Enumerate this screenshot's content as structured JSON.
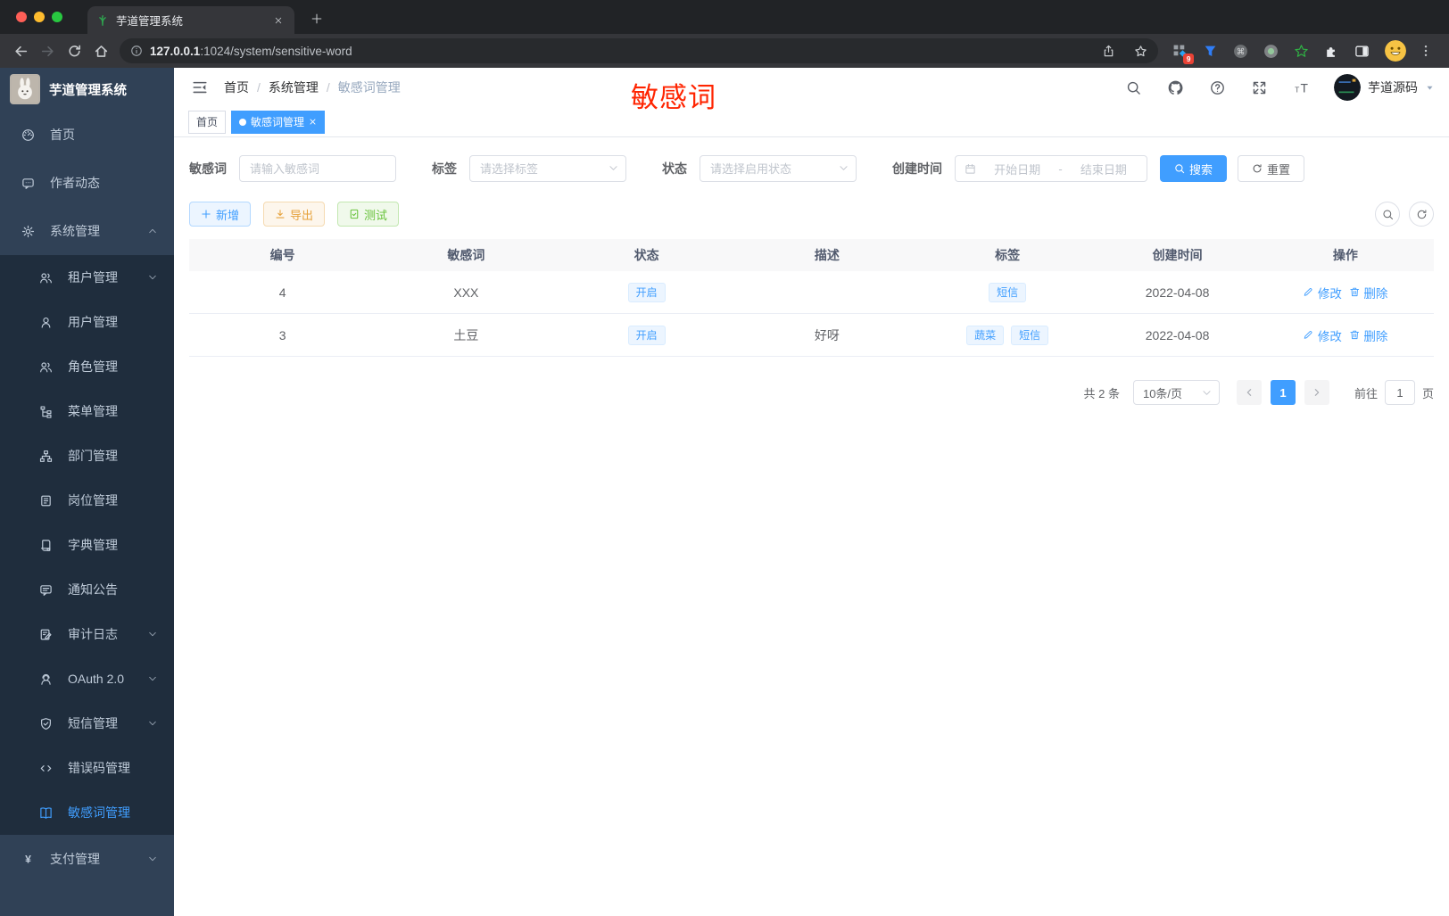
{
  "colors": {
    "accent": "#409eff",
    "warning": "#e6a23c",
    "success": "#67c23a",
    "annotation_red": "#ff2400",
    "sidebar_bg": "#304156",
    "submenu_bg": "#1f2d3d"
  },
  "browser": {
    "tab_title": "芋道管理系统",
    "url_host": "127.0.0.1",
    "url_path": ":1024/system/sensitive-word",
    "extension_badge": "9"
  },
  "sidebar": {
    "title": "芋道管理系统",
    "menu": [
      {
        "label": "首页",
        "icon": "dashboard"
      },
      {
        "label": "作者动态",
        "icon": "chat"
      },
      {
        "label": "系统管理",
        "icon": "gear",
        "expanded": true,
        "children": [
          {
            "label": "租户管理",
            "icon": "users",
            "arrow": true
          },
          {
            "label": "用户管理",
            "icon": "user"
          },
          {
            "label": "角色管理",
            "icon": "users"
          },
          {
            "label": "菜单管理",
            "icon": "tree"
          },
          {
            "label": "部门管理",
            "icon": "org"
          },
          {
            "label": "岗位管理",
            "icon": "badge"
          },
          {
            "label": "字典管理",
            "icon": "dict"
          },
          {
            "label": "通知公告",
            "icon": "announce"
          },
          {
            "label": "审计日志",
            "icon": "log",
            "arrow": true
          },
          {
            "label": "OAuth 2.0",
            "icon": "oauth",
            "arrow": true
          },
          {
            "label": "短信管理",
            "icon": "shield",
            "arrow": true
          },
          {
            "label": "错误码管理",
            "icon": "code"
          },
          {
            "label": "敏感词管理",
            "icon": "book",
            "active": true
          }
        ]
      },
      {
        "label": "支付管理",
        "icon": "yen",
        "arrow": true
      }
    ]
  },
  "header": {
    "breadcrumb": [
      "首页",
      "系统管理",
      "敏感词管理"
    ],
    "annotation": "敏感词",
    "user_name": "芋道源码"
  },
  "tags_view": [
    {
      "label": "首页"
    },
    {
      "label": "敏感词管理",
      "active": true,
      "closable": true
    }
  ],
  "filters": {
    "keyword_label": "敏感词",
    "keyword_placeholder": "请输入敏感词",
    "tag_label": "标签",
    "tag_placeholder": "请选择标签",
    "status_label": "状态",
    "status_placeholder": "请选择启用状态",
    "date_label": "创建时间",
    "date_start_placeholder": "开始日期",
    "date_separator": "-",
    "date_end_placeholder": "结束日期",
    "search_label": "搜索",
    "reset_label": "重置"
  },
  "toolbar": {
    "add_label": "新增",
    "export_label": "导出",
    "test_label": "测试"
  },
  "table": {
    "columns": [
      "编号",
      "敏感词",
      "状态",
      "描述",
      "标签",
      "创建时间",
      "操作"
    ],
    "edit_label": "修改",
    "delete_label": "删除",
    "rows": [
      {
        "id": "4",
        "word": "XXX",
        "status": "开启",
        "description": "",
        "tags": [
          "短信"
        ],
        "created_at": "2022-04-08"
      },
      {
        "id": "3",
        "word": "土豆",
        "status": "开启",
        "description": "好呀",
        "tags": [
          "蔬菜",
          "短信"
        ],
        "created_at": "2022-04-08"
      }
    ]
  },
  "pagination": {
    "total_text": "共 2 条",
    "page_size": "10条/页",
    "current_page": "1",
    "goto_label": "前往",
    "goto_value": "1",
    "page_suffix": "页"
  }
}
